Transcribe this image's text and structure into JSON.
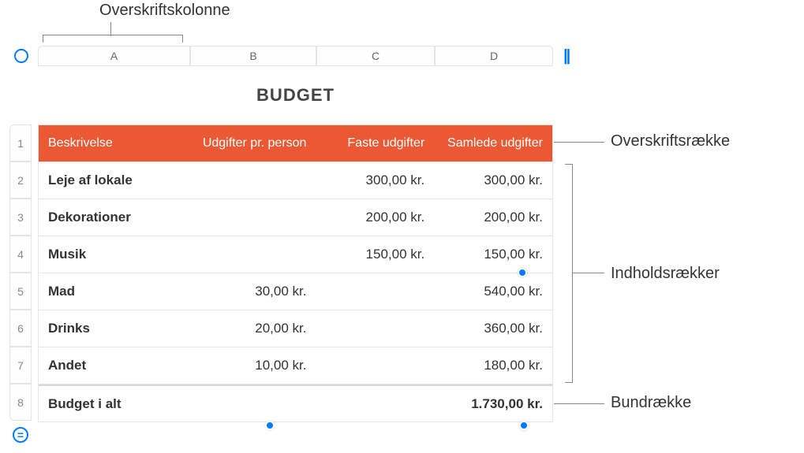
{
  "callouts": {
    "header_column": "Overskriftskolonne",
    "header_row": "Overskriftsrække",
    "body_rows": "Indholdsrækker",
    "footer_row": "Bundrække"
  },
  "columns": {
    "a": "A",
    "b": "B",
    "c": "C",
    "d": "D"
  },
  "rows": [
    "1",
    "2",
    "3",
    "4",
    "5",
    "6",
    "7",
    "8"
  ],
  "title": "BUDGET",
  "header": {
    "description": "Beskrivelse",
    "per_person": "Udgifter pr. person",
    "fixed": "Faste udgifter",
    "total": "Samlede udgifter"
  },
  "data": [
    {
      "desc": "Leje af lokale",
      "per": "",
      "fixed": "300,00 kr.",
      "total": "300,00 kr."
    },
    {
      "desc": "Dekorationer",
      "per": "",
      "fixed": "200,00 kr.",
      "total": "200,00 kr."
    },
    {
      "desc": "Musik",
      "per": "",
      "fixed": "150,00 kr.",
      "total": "150,00 kr."
    },
    {
      "desc": "Mad",
      "per": "30,00 kr.",
      "fixed": "",
      "total": "540,00 kr."
    },
    {
      "desc": "Drinks",
      "per": "20,00 kr.",
      "fixed": "",
      "total": "360,00 kr."
    },
    {
      "desc": "Andet",
      "per": "10,00 kr.",
      "fixed": "",
      "total": "180,00 kr."
    }
  ],
  "footer": {
    "label": "Budget i alt",
    "total": "1.730,00 kr."
  },
  "icons": {
    "equals": "="
  }
}
